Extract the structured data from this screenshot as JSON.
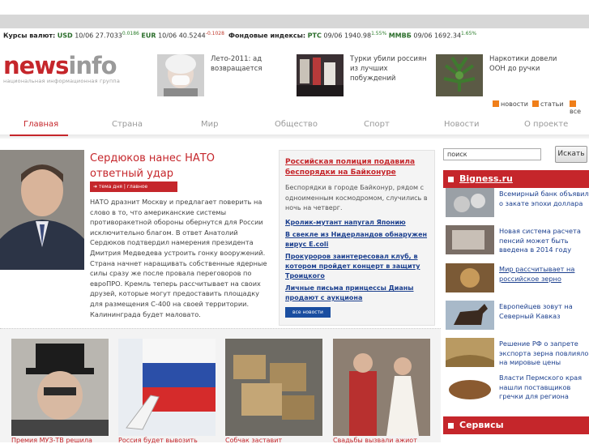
{
  "ticker": {
    "currency_label": "Курсы валют:",
    "usd_code": "USD",
    "usd_value": "10/06 27.7033",
    "usd_change": "0.0186",
    "eur_code": "EUR",
    "eur_value": "10/06 40.5244",
    "eur_change": "-0.1028",
    "index_label": "Фондовые индексы:",
    "rts_code": "РТС",
    "rts_value": "09/06 1940.98",
    "rts_change": "1.55%",
    "micex_code": "ММВБ",
    "micex_value": "09/06 1692.34",
    "micex_change": "1.65%"
  },
  "logo": {
    "part1": "news",
    "part2": "info",
    "tagline": "национальная информационная группа"
  },
  "teasers": [
    {
      "text": "Лето-2011: ад возвращается"
    },
    {
      "text": "Турки убили россиян из лучших побуждений"
    },
    {
      "text": "Наркотики довели ООН до ручки"
    }
  ],
  "rss": {
    "news": "новости",
    "articles": "статьи",
    "all": "все"
  },
  "nav": [
    "Главная",
    "Страна",
    "Мир",
    "Общество",
    "Спорт",
    "Новости",
    "О проекте"
  ],
  "lead": {
    "title": "Сердюков нанес НАТО ответный удар",
    "tag": "тема дня | главное",
    "body": "НАТО дразнит Москву и предлагает поверить на слово в то, что американские системы противоракетной обороны обернутся для России исключительно благом. В ответ Анатолий Сердюков подтвердил намерения президента Дмитрия Медведева устроить гонку вооружений. Страна начнет наращивать собственные ядерные силы сразу же после провала переговоров по евроПРО. Кремль теперь рассчитывает на своих друзей, которые могут предоставить площадку для размещения С-400 на своей территории. Калининграда будет маловато."
  },
  "newsbox": {
    "headline": "Российская полиция подавила беспорядки на Байконуре",
    "body": "Беспорядки в городе Байконур, рядом с одноименным космодромом, случились в ночь на четверг.",
    "links": [
      "Кролик-мутант напугал Японию",
      "В свекле из Нидерландов обнаружен вирус E.coli",
      "Прокуроров заинтересовал клуб, в котором пройдет концерт в защиту Троицкого",
      "Личные письма принцессы Дианы продают с аукциона"
    ],
    "all_button": "все новости"
  },
  "gallery": [
    {
      "caption": "Премия МУЗ-ТВ решила"
    },
    {
      "caption": "Россия будет вывозить"
    },
    {
      "caption": "Собчак заставит"
    },
    {
      "caption": "Свадьбы вызвали ажиот"
    }
  ],
  "search": {
    "value": "поиск",
    "button": "Искать"
  },
  "right": {
    "bigness_title": "Bigness.ru",
    "items": [
      {
        "text": "Всемирный банк объявил о закате эпохи доллара"
      },
      {
        "text": "Новая система расчета пенсий может быть введена в 2014 году"
      },
      {
        "text": "Мир рассчитывает на российское зерно"
      },
      {
        "text": "Европейцев зовут на Северный Кавказ"
      },
      {
        "text": "Решение РФ о запрете экспорта зерна повлияло на мировые цены"
      },
      {
        "text": "Власти Пермского края нашли поставщиков гречки для региона"
      }
    ],
    "services_title": "Сервисы"
  }
}
